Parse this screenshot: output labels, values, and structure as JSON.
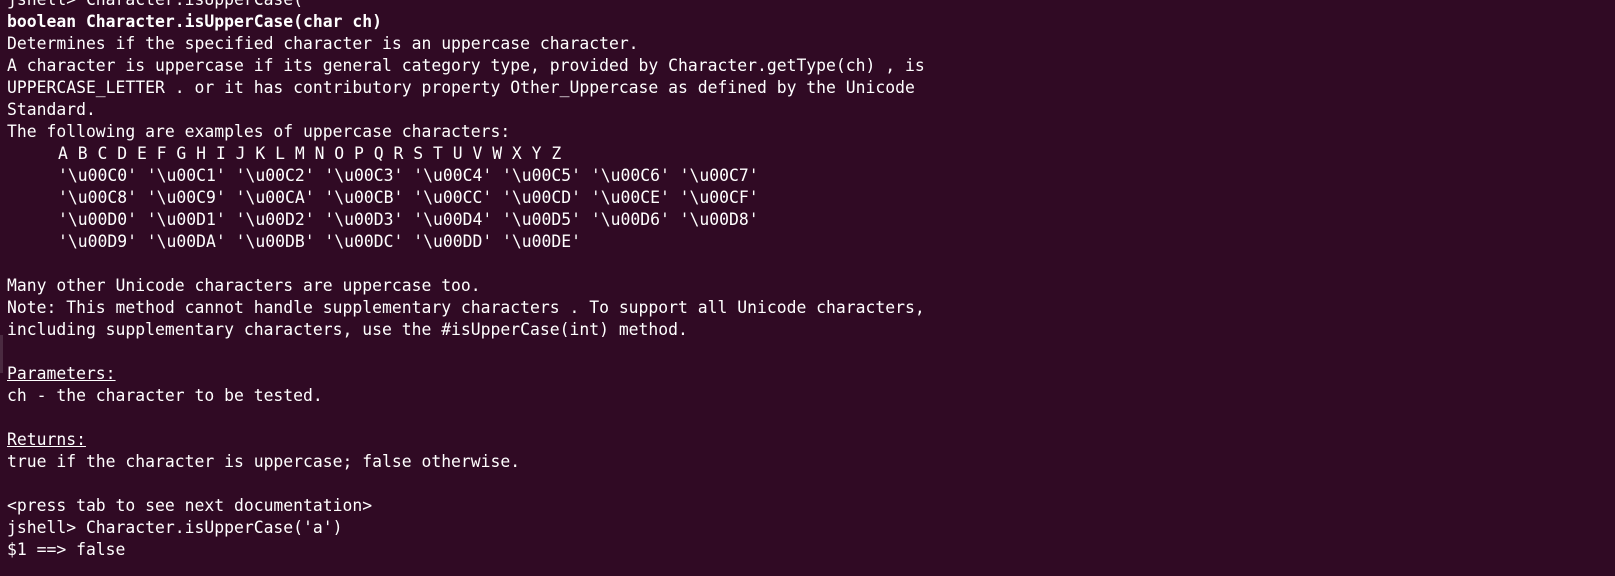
{
  "terminal": {
    "prev_command": "jshell> Character.isUpperCase(",
    "signature": "boolean Character.isUpperCase(char ch)",
    "desc_1": "Determines if the specified character is an uppercase character.",
    "desc_2": "A character is uppercase if its general category type, provided by Character.getType(ch) , is",
    "desc_3": "UPPERCASE_LETTER . or it has contributory property Other_Uppercase as defined by the Unicode",
    "desc_4": "Standard.",
    "examples_intro": "The following are examples of uppercase characters:",
    "examples": [
      "A B C D E F G H I J K L M N O P Q R S T U V W X Y Z",
      "'\\u00C0' '\\u00C1' '\\u00C2' '\\u00C3' '\\u00C4' '\\u00C5' '\\u00C6' '\\u00C7'",
      "'\\u00C8' '\\u00C9' '\\u00CA' '\\u00CB' '\\u00CC' '\\u00CD' '\\u00CE' '\\u00CF'",
      "'\\u00D0' '\\u00D1' '\\u00D2' '\\u00D3' '\\u00D4' '\\u00D5' '\\u00D6' '\\u00D8'",
      "'\\u00D9' '\\u00DA' '\\u00DB' '\\u00DC' '\\u00DD' '\\u00DE'"
    ],
    "many_other": "Many other Unicode characters are uppercase too.",
    "note_1": "Note: This method cannot handle supplementary characters . To support all Unicode characters,",
    "note_2": "including supplementary characters, use the #isUpperCase(int) method.",
    "params_heading": "Parameters:",
    "params_text": "ch - the character to be tested.",
    "returns_heading": "Returns:",
    "returns_text": "true if the character is uppercase; false otherwise.",
    "hint": "<press tab to see next documentation>",
    "command": "jshell> Character.isUpperCase('a')",
    "result": "$1 ==> false"
  }
}
